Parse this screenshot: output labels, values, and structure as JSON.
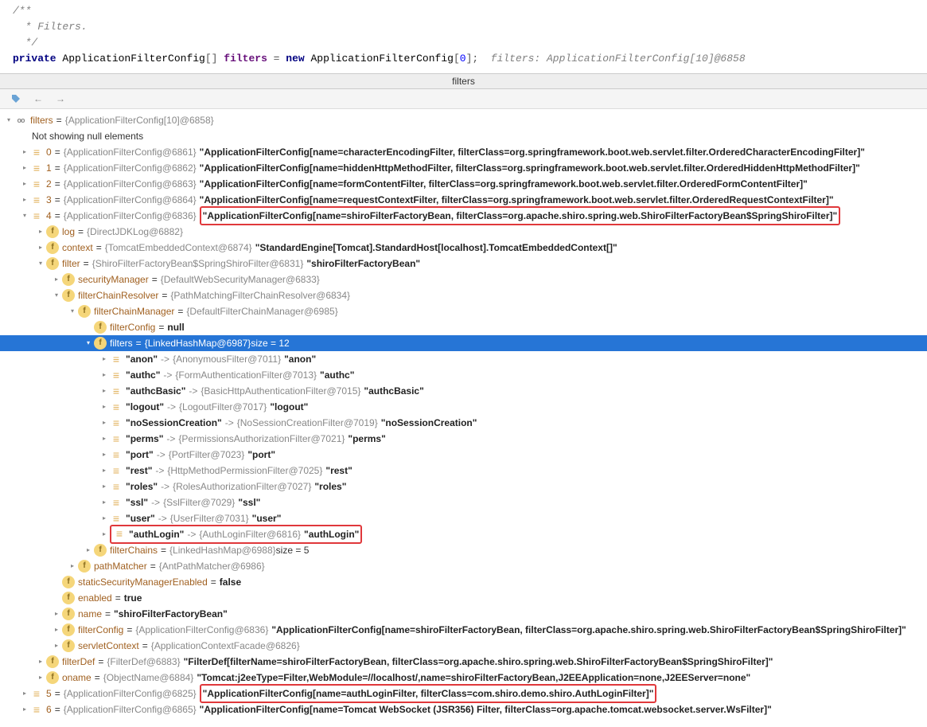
{
  "code": {
    "comment1": "/**",
    "comment2": " * Filters.",
    "comment3": " */",
    "kw_private": "private",
    "cls_afc": "ApplicationFilterConfig",
    "field_filters": "filters",
    "kw_new": "new",
    "zero": "0",
    "hint": "filters: ApplicationFilterConfig[10]@6858"
  },
  "panel_title": "filters",
  "root": {
    "label": "filters",
    "eq": "=",
    "val": "{ApplicationFilterConfig[10]@6858}"
  },
  "not_showing": "Not showing null elements",
  "arr": [
    {
      "idx": "0",
      "gray": "{ApplicationFilterConfig@6861}",
      "val": "\"ApplicationFilterConfig[name=characterEncodingFilter, filterClass=org.springframework.boot.web.servlet.filter.OrderedCharacterEncodingFilter]\""
    },
    {
      "idx": "1",
      "gray": "{ApplicationFilterConfig@6862}",
      "val": "\"ApplicationFilterConfig[name=hiddenHttpMethodFilter, filterClass=org.springframework.boot.web.servlet.filter.OrderedHiddenHttpMethodFilter]\""
    },
    {
      "idx": "2",
      "gray": "{ApplicationFilterConfig@6863}",
      "val": "\"ApplicationFilterConfig[name=formContentFilter, filterClass=org.springframework.boot.web.servlet.filter.OrderedFormContentFilter]\""
    },
    {
      "idx": "3",
      "gray": "{ApplicationFilterConfig@6864}",
      "val": "\"ApplicationFilterConfig[name=requestContextFilter, filterClass=org.springframework.boot.web.servlet.filter.OrderedRequestContextFilter]\""
    },
    {
      "idx": "4",
      "gray": "{ApplicationFilterConfig@6836}",
      "val": "\"ApplicationFilterConfig[name=shiroFilterFactoryBean, filterClass=org.apache.shiro.spring.web.ShiroFilterFactoryBean$SpringShiroFilter]\""
    },
    {
      "idx": "5",
      "gray": "{ApplicationFilterConfig@6825}",
      "val": "\"ApplicationFilterConfig[name=authLoginFilter, filterClass=com.shiro.demo.shiro.AuthLoginFilter]\""
    },
    {
      "idx": "6",
      "gray": "{ApplicationFilterConfig@6865}",
      "val": "\"ApplicationFilterConfig[name=Tomcat WebSocket (JSR356) Filter, filterClass=org.apache.tomcat.websocket.server.WsFilter]\""
    }
  ],
  "n4": {
    "log": {
      "name": "log",
      "gray": "{DirectJDKLog@6882}"
    },
    "context": {
      "name": "context",
      "gray": "{TomcatEmbeddedContext@6874}",
      "val": "\"StandardEngine[Tomcat].StandardHost[localhost].TomcatEmbeddedContext[]\""
    },
    "filter": {
      "name": "filter",
      "gray": "{ShiroFilterFactoryBean$SpringShiroFilter@6831}",
      "val": "\"shiroFilterFactoryBean\""
    },
    "securityManager": {
      "name": "securityManager",
      "gray": "{DefaultWebSecurityManager@6833}"
    },
    "filterChainResolver": {
      "name": "filterChainResolver",
      "gray": "{PathMatchingFilterChainResolver@6834}"
    },
    "filterChainManager": {
      "name": "filterChainManager",
      "gray": "{DefaultFilterChainManager@6985}"
    },
    "filterConfig": {
      "name": "filterConfig",
      "val": "null"
    },
    "filters": {
      "name": "filters",
      "gray": "{LinkedHashMap@6987}",
      "suffix": " size = 12"
    },
    "filterChains": {
      "name": "filterChains",
      "gray": "{LinkedHashMap@6988}",
      "suffix": " size = 5"
    },
    "pathMatcher": {
      "name": "pathMatcher",
      "gray": "{AntPathMatcher@6986}"
    },
    "staticSec": {
      "name": "staticSecurityManagerEnabled",
      "val": "false"
    },
    "enabled": {
      "name": "enabled",
      "val": "true"
    },
    "name": {
      "name": "name",
      "val": "\"shiroFilterFactoryBean\""
    },
    "filterConfig2": {
      "name": "filterConfig",
      "gray": "{ApplicationFilterConfig@6836}",
      "val": "\"ApplicationFilterConfig[name=shiroFilterFactoryBean, filterClass=org.apache.shiro.spring.web.ShiroFilterFactoryBean$SpringShiroFilter]\""
    },
    "servletContext": {
      "name": "servletContext",
      "gray": "{ApplicationContextFacade@6826}"
    },
    "filterDef": {
      "name": "filterDef",
      "gray": "{FilterDef@6883}",
      "val": "\"FilterDef[filterName=shiroFilterFactoryBean, filterClass=org.apache.shiro.spring.web.ShiroFilterFactoryBean$SpringShiroFilter]\""
    },
    "oname": {
      "name": "oname",
      "gray": "{ObjectName@6884}",
      "val": "\"Tomcat:j2eeType=Filter,WebModule=//localhost/,name=shiroFilterFactoryBean,J2EEApplication=none,J2EEServer=none\""
    }
  },
  "map": [
    {
      "key": "\"anon\"",
      "gray": "{AnonymousFilter@7011}",
      "val": "\"anon\""
    },
    {
      "key": "\"authc\"",
      "gray": "{FormAuthenticationFilter@7013}",
      "val": "\"authc\""
    },
    {
      "key": "\"authcBasic\"",
      "gray": "{BasicHttpAuthenticationFilter@7015}",
      "val": "\"authcBasic\""
    },
    {
      "key": "\"logout\"",
      "gray": "{LogoutFilter@7017}",
      "val": "\"logout\""
    },
    {
      "key": "\"noSessionCreation\"",
      "gray": "{NoSessionCreationFilter@7019}",
      "val": "\"noSessionCreation\""
    },
    {
      "key": "\"perms\"",
      "gray": "{PermissionsAuthorizationFilter@7021}",
      "val": "\"perms\""
    },
    {
      "key": "\"port\"",
      "gray": "{PortFilter@7023}",
      "val": "\"port\""
    },
    {
      "key": "\"rest\"",
      "gray": "{HttpMethodPermissionFilter@7025}",
      "val": "\"rest\""
    },
    {
      "key": "\"roles\"",
      "gray": "{RolesAuthorizationFilter@7027}",
      "val": "\"roles\""
    },
    {
      "key": "\"ssl\"",
      "gray": "{SslFilter@7029}",
      "val": "\"ssl\""
    },
    {
      "key": "\"user\"",
      "gray": "{UserFilter@7031}",
      "val": "\"user\""
    },
    {
      "key": "\"authLogin\"",
      "gray": "{AuthLoginFilter@6816}",
      "val": "\"authLogin\""
    }
  ]
}
